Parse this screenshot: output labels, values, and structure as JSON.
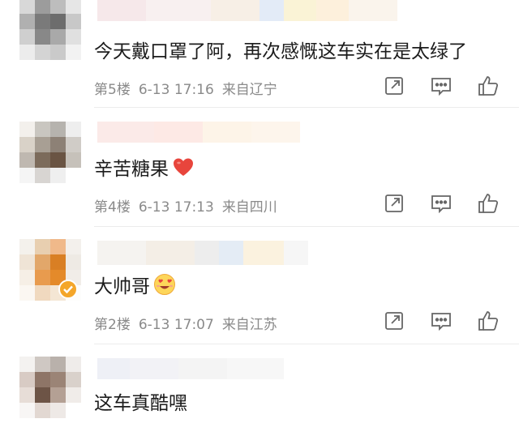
{
  "comments": [
    {
      "text": "今天戴口罩了阿，再次感慨这车实在是太绿了",
      "floor": "第5楼",
      "time": "6-13 17:16",
      "location": "来自辽宁",
      "emoji": null
    },
    {
      "text": "辛苦糖果",
      "floor": "第4楼",
      "time": "6-13 17:13",
      "location": "来自四川",
      "emoji": "red-heart"
    },
    {
      "text": "大帅哥",
      "floor": "第2楼",
      "time": "6-13 17:07",
      "location": "来自江苏",
      "emoji": "heart-eyes-face",
      "verified": true
    },
    {
      "text": "这车真酷嘿",
      "floor": "",
      "time": "",
      "location": "",
      "emoji": null
    }
  ],
  "icons": {
    "share": "share-icon",
    "reply": "comment-icon",
    "like": "thumbs-up-icon"
  },
  "colors": {
    "verified_badge": "#f4a62a",
    "heart": "#e8453c",
    "meta_text": "#8a8a8a"
  }
}
